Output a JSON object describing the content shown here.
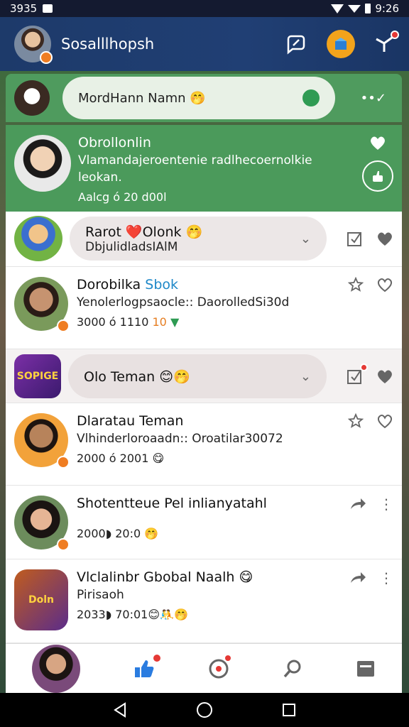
{
  "status": {
    "time_left": "3935",
    "time_right": "9:26"
  },
  "appbar": {
    "title": "Sosalllhopsh"
  },
  "composer": {
    "placeholder_text": "MordHann Namn 🤭",
    "more": "••✓"
  },
  "featured": {
    "name": "Obrollonlin",
    "line1": "Vlamandajeroentenie radlhecoernolkie",
    "line2": "leokan.",
    "meta": "Aalcg ó 20 d00l"
  },
  "items": [
    {
      "name": "Rarot ❤️Olonk 🤭",
      "sub": "DbjulidladsIAlM"
    },
    {
      "name": "Dorobilka",
      "name_link": "Sbok",
      "sub": "Yenolerlogpsaocle:: DaorolledSi30d",
      "meta_a": "3000 ó 1110",
      "meta_b": "10"
    },
    {
      "name": "Olo Teman 😊🤭",
      "sq_label": "SOPIGE"
    },
    {
      "name": "Dlaratau Teman",
      "sub": "Vlhinderloroaadn:: Oroatilar30072",
      "meta": "2000 ó 2001 😋"
    },
    {
      "name": "Shotentteue Pel inlianyatahl",
      "meta": "2000◗ 20:0 🤭"
    },
    {
      "name": "Vlclalinbr Gbobal Naalh 😋",
      "sub": "Pirisaoh",
      "meta": "2033◗ 70:01😊🤼🤭",
      "sq_label": "Doln"
    }
  ],
  "colors": {
    "accent_green": "#4b9a5b",
    "appbar": "#1d3a6a",
    "badge": "#ef7d22",
    "alert": "#e53935"
  }
}
